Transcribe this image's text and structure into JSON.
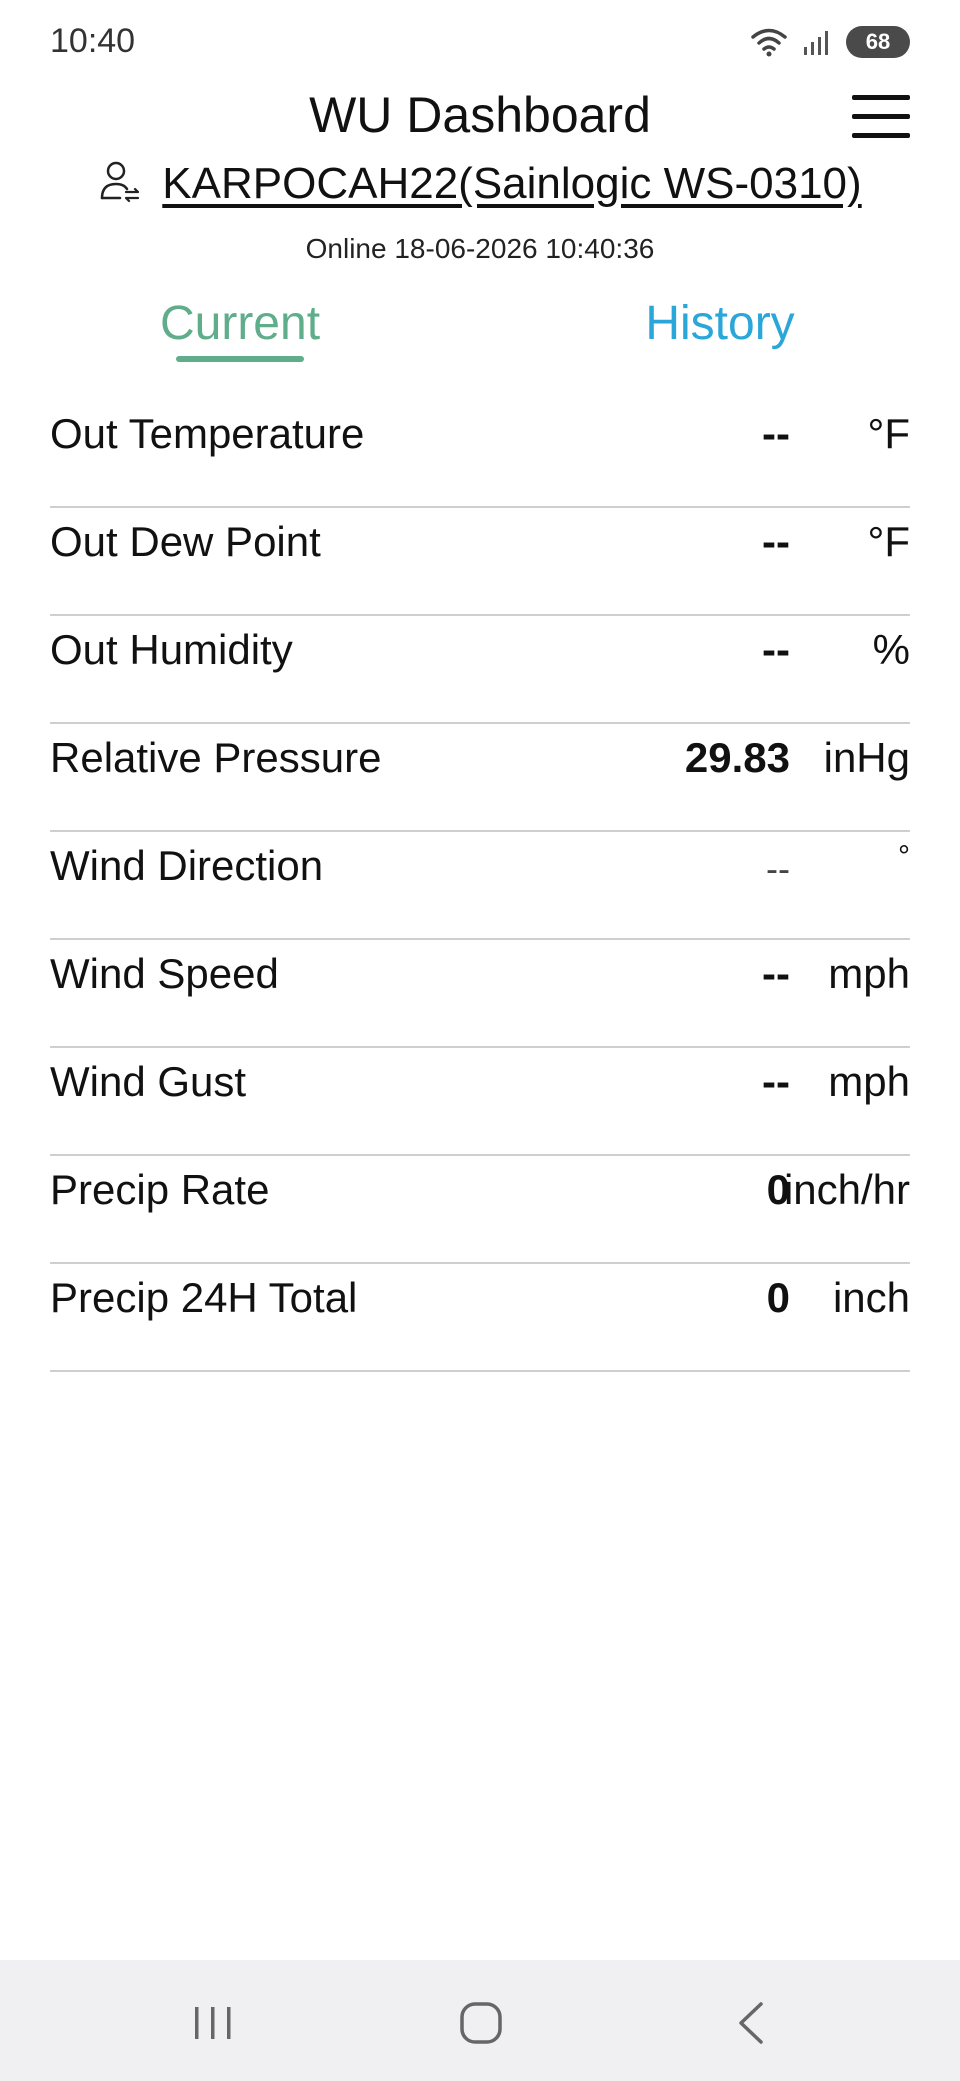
{
  "status_bar": {
    "time": "10:40",
    "battery": "68",
    "icons": [
      "wifi-icon",
      "signal-icon",
      "battery-icon"
    ]
  },
  "header": {
    "title": "WU Dashboard",
    "menu_icon": "hamburger-menu-icon",
    "station_icon": "user-switch-icon",
    "station": "KARPOCAH22(Sainlogic WS-0310)",
    "online_status": "Online 18-06-2026 10:40:36"
  },
  "tabs": {
    "current": "Current",
    "history": "History",
    "active": "Current"
  },
  "readings": [
    {
      "label": "Out Temperature",
      "value": "--",
      "unit": "°F"
    },
    {
      "label": "Out Dew Point",
      "value": "--",
      "unit": "°F"
    },
    {
      "label": "Out Humidity",
      "value": "--",
      "unit": "%"
    },
    {
      "label": "Relative Pressure",
      "value": "29.83",
      "unit": "inHg"
    },
    {
      "label": "Wind Direction",
      "value": "--",
      "unit": "°"
    },
    {
      "label": "Wind Speed",
      "value": "--",
      "unit": "mph"
    },
    {
      "label": "Wind Gust",
      "value": "--",
      "unit": "mph"
    },
    {
      "label": "Precip Rate",
      "value": "0",
      "unit": "inch/hr"
    },
    {
      "label": "Precip 24H Total",
      "value": "0",
      "unit": "inch"
    }
  ],
  "nav_bar": {
    "icons": [
      "recents-icon",
      "home-icon",
      "back-icon"
    ]
  },
  "colors": {
    "tab_current": "#5fad8a",
    "tab_history": "#2aa6d9",
    "divider": "#cfcfcf",
    "nav_background": "#f0f0f2"
  }
}
